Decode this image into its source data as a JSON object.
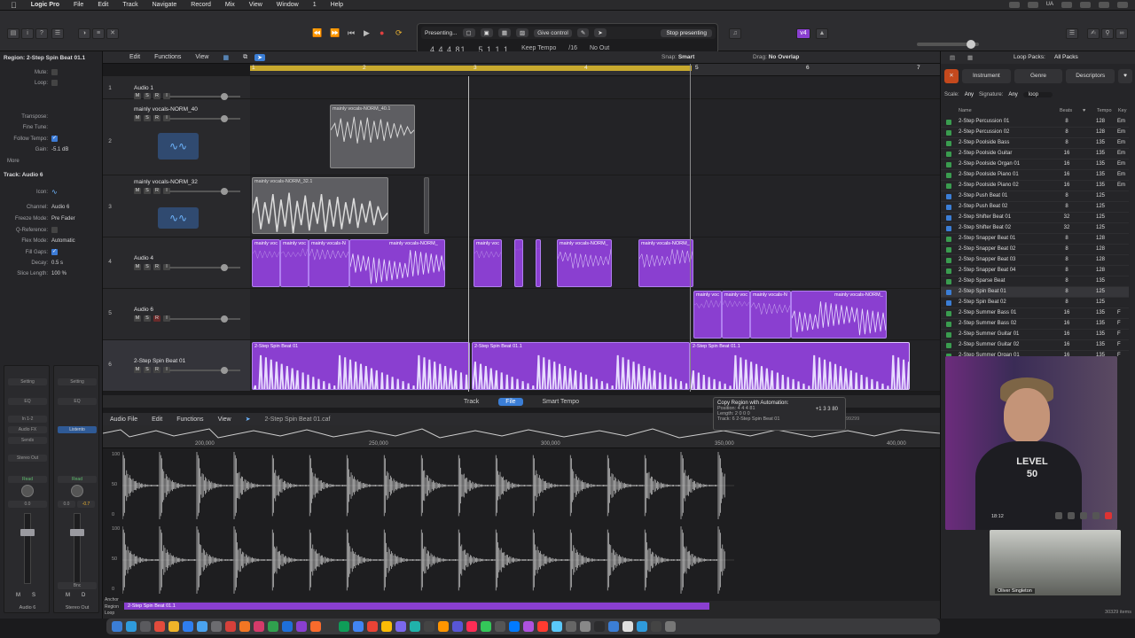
{
  "menubar": {
    "app": "Logic Pro",
    "items": [
      "File",
      "Edit",
      "Track",
      "Navigate",
      "Record",
      "Mix",
      "View",
      "Window",
      "1",
      "Help"
    ],
    "keyboard": "UA"
  },
  "lcd": {
    "presenting": "Presenting...",
    "give_control": "Give control",
    "stop_presenting": "Stop presenting",
    "position": "4 4 4  81",
    "position2": "5 1 1  1",
    "tempo_mode": "Keep Tempo",
    "division": "/16",
    "out": "No Out"
  },
  "controlbar": {
    "badge": "v4"
  },
  "inspector": {
    "region_title": "Region: 2-Step Spin Beat 01.1",
    "mute_label": "Mute:",
    "loop_label": "Loop:",
    "transpose_label": "Transpose:",
    "fine_tune_label": "Fine Tune:",
    "follow_tempo_label": "Follow Tempo:",
    "gain_label": "Gain:",
    "gain_value": "-5.1 dB",
    "more_label": "More",
    "track_title": "Track: Audio 6",
    "icon_label": "Icon:",
    "channel_label": "Channel:",
    "channel_value": "Audio 6",
    "freeze_label": "Freeze Mode:",
    "freeze_value": "Pre Fader",
    "qref_label": "Q-Reference:",
    "flex_label": "Flex Mode:",
    "flex_value": "Automatic",
    "fillgaps_label": "Fill Gaps:",
    "decay_label": "Decay:",
    "decay_value": "0.5 s",
    "slice_label": "Slice Length:",
    "slice_value": "100 %",
    "strip1": {
      "setting": "Setting",
      "eq": "EQ",
      "input": "In 1-2",
      "fx": "Audio FX",
      "sends": "Sends",
      "output": "Stereo Out",
      "read": "Read",
      "pan": "0.0",
      "name": "Audio 6"
    },
    "strip2": {
      "setting": "Setting",
      "eq": "EQ",
      "input": "Listento",
      "fx": "",
      "sends": "",
      "output": "Stereo Out",
      "read": "Read",
      "pan": "0.0",
      "pan2": "-0.7",
      "name": "Stereo Out",
      "bounce": "Bnc"
    }
  },
  "tracks_toolbar": {
    "edit": "Edit",
    "functions": "Functions",
    "view": "View",
    "snap_label": "Snap:",
    "snap_value": "Smart",
    "drag_label": "Drag:",
    "drag_value": "No Overlap"
  },
  "ruler": {
    "bars": [
      "1",
      "2",
      "3",
      "4",
      "5",
      "6",
      "7"
    ]
  },
  "tracks": [
    {
      "num": "1",
      "name": "Audio 1"
    },
    {
      "num": "2",
      "name": "mainly vocals-NORM_40"
    },
    {
      "num": "3",
      "name": "mainly vocals-NORM_32"
    },
    {
      "num": "4",
      "name": "Audio 4"
    },
    {
      "num": "5",
      "name": "Audio 6"
    },
    {
      "num": "6",
      "name": "2-Step Spin Beat 01"
    }
  ],
  "regions": {
    "r2": "mainly vocals-NORM_40.1",
    "r3": "mainly vocals-NORM_32.1",
    "r4a": "mainly voc",
    "r4b": "mainly voc",
    "r4c": "mainly vocals-N",
    "r4d": "mainly vocals-NORM_",
    "r4e": "mainly voc",
    "r4f": "mainly vocals-NORM_",
    "r4g": "mainly vocals-NORM_",
    "r5a": "mainly voc",
    "r5b": "mainly voc",
    "r5c": "mainly vocals-N",
    "r5d": "mainly vocals-NORM_",
    "r6a": "2-Step Spin Beat 01",
    "r6b": "2-Step Spin Beat 01.1",
    "r6c": "2-Step Spin Beat 01.1"
  },
  "editor": {
    "tabs": [
      "Track",
      "File",
      "Smart Tempo"
    ],
    "active_tab": "File",
    "audio_file": "Audio File",
    "edit": "Edit",
    "functions": "Functions",
    "view": "View",
    "file_name": "2-Step Spin Beat 01.caf",
    "ruler": [
      "200,000",
      "250,000",
      "300,000",
      "350,000",
      "400,000"
    ],
    "y_top": "100",
    "y_mid": "50",
    "y_zero": "0",
    "region_bar": "2-Step Spin Beat 01.1",
    "anchor": "Anchor",
    "region_label": "Region",
    "loop_label": "Loop"
  },
  "tooltip": {
    "title": "Copy Region with Automation:",
    "position": "Position:  4 4 4 81",
    "delta": "+1 3 3 80",
    "length": "Length:  2 0 0 0",
    "track": "Track:  6  2-Step Spin Beat 01",
    "ruler_value": "99299"
  },
  "loop_browser": {
    "title": "Loop Packs:",
    "pack": "All Packs",
    "tabs": [
      "Instrument",
      "Genre",
      "Descriptors"
    ],
    "scale_label": "Scale:",
    "scale_value": "Any",
    "signature_label": "Signature:",
    "signature_value": "Any",
    "search_value": "loop",
    "col_name": "Name",
    "col_beats": "Beats",
    "col_tempo": "Tempo",
    "col_key": "Key",
    "items": [
      {
        "name": "2-Step Percussion 01",
        "beats": "8",
        "tempo": "128",
        "key": "Em",
        "type": "green"
      },
      {
        "name": "2-Step Percussion 02",
        "beats": "8",
        "tempo": "128",
        "key": "Em",
        "type": "green"
      },
      {
        "name": "2-Step Poolside Bass",
        "beats": "8",
        "tempo": "135",
        "key": "Em",
        "type": "green"
      },
      {
        "name": "2-Step Poolside Guitar",
        "beats": "16",
        "tempo": "135",
        "key": "Em",
        "type": "green"
      },
      {
        "name": "2-Step Poolside Organ 01",
        "beats": "16",
        "tempo": "135",
        "key": "Em",
        "type": "green"
      },
      {
        "name": "2-Step Poolside Piano 01",
        "beats": "16",
        "tempo": "135",
        "key": "Em",
        "type": "green"
      },
      {
        "name": "2-Step Poolside Piano 02",
        "beats": "16",
        "tempo": "135",
        "key": "Em",
        "type": "green"
      },
      {
        "name": "2-Step Push Beat 01",
        "beats": "8",
        "tempo": "125",
        "key": "",
        "type": "blue"
      },
      {
        "name": "2-Step Push Beat 02",
        "beats": "8",
        "tempo": "125",
        "key": "",
        "type": "blue"
      },
      {
        "name": "2-Step Shifter Beat 01",
        "beats": "32",
        "tempo": "125",
        "key": "",
        "type": "blue"
      },
      {
        "name": "2-Step Shifter Beat 02",
        "beats": "32",
        "tempo": "125",
        "key": "",
        "type": "blue"
      },
      {
        "name": "2-Step Snapper Beat 01",
        "beats": "8",
        "tempo": "128",
        "key": "",
        "type": "green"
      },
      {
        "name": "2-Step Snapper Beat 02",
        "beats": "8",
        "tempo": "128",
        "key": "",
        "type": "green"
      },
      {
        "name": "2-Step Snapper Beat 03",
        "beats": "8",
        "tempo": "128",
        "key": "",
        "type": "green"
      },
      {
        "name": "2-Step Snapper Beat 04",
        "beats": "8",
        "tempo": "128",
        "key": "",
        "type": "green"
      },
      {
        "name": "2-Step Sparse Beat",
        "beats": "8",
        "tempo": "135",
        "key": "",
        "type": "green"
      },
      {
        "name": "2-Step Spin Beat 01",
        "beats": "8",
        "tempo": "125",
        "key": "",
        "type": "blue"
      },
      {
        "name": "2-Step Spin Beat 02",
        "beats": "8",
        "tempo": "125",
        "key": "",
        "type": "blue"
      },
      {
        "name": "2-Step Summer Bass 01",
        "beats": "16",
        "tempo": "135",
        "key": "F",
        "type": "green"
      },
      {
        "name": "2-Step Summer Bass 02",
        "beats": "16",
        "tempo": "135",
        "key": "F",
        "type": "green"
      },
      {
        "name": "2-Step Summer Guitar 01",
        "beats": "16",
        "tempo": "135",
        "key": "F",
        "type": "green"
      },
      {
        "name": "2-Step Summer Guitar 02",
        "beats": "16",
        "tempo": "135",
        "key": "F",
        "type": "green"
      },
      {
        "name": "2-Step Summer Organ 01",
        "beats": "16",
        "tempo": "135",
        "key": "F",
        "type": "green"
      }
    ],
    "footer_count": "30329 items"
  },
  "webcam": {
    "shirt_text": "LEVEL 50",
    "participant_name": "Oliver Singleton",
    "time": "18:12"
  },
  "colors": {
    "region_purple": "#8a3fd0",
    "accent_blue": "#3b7ed6",
    "cycle_yellow": "#c8a92e"
  }
}
